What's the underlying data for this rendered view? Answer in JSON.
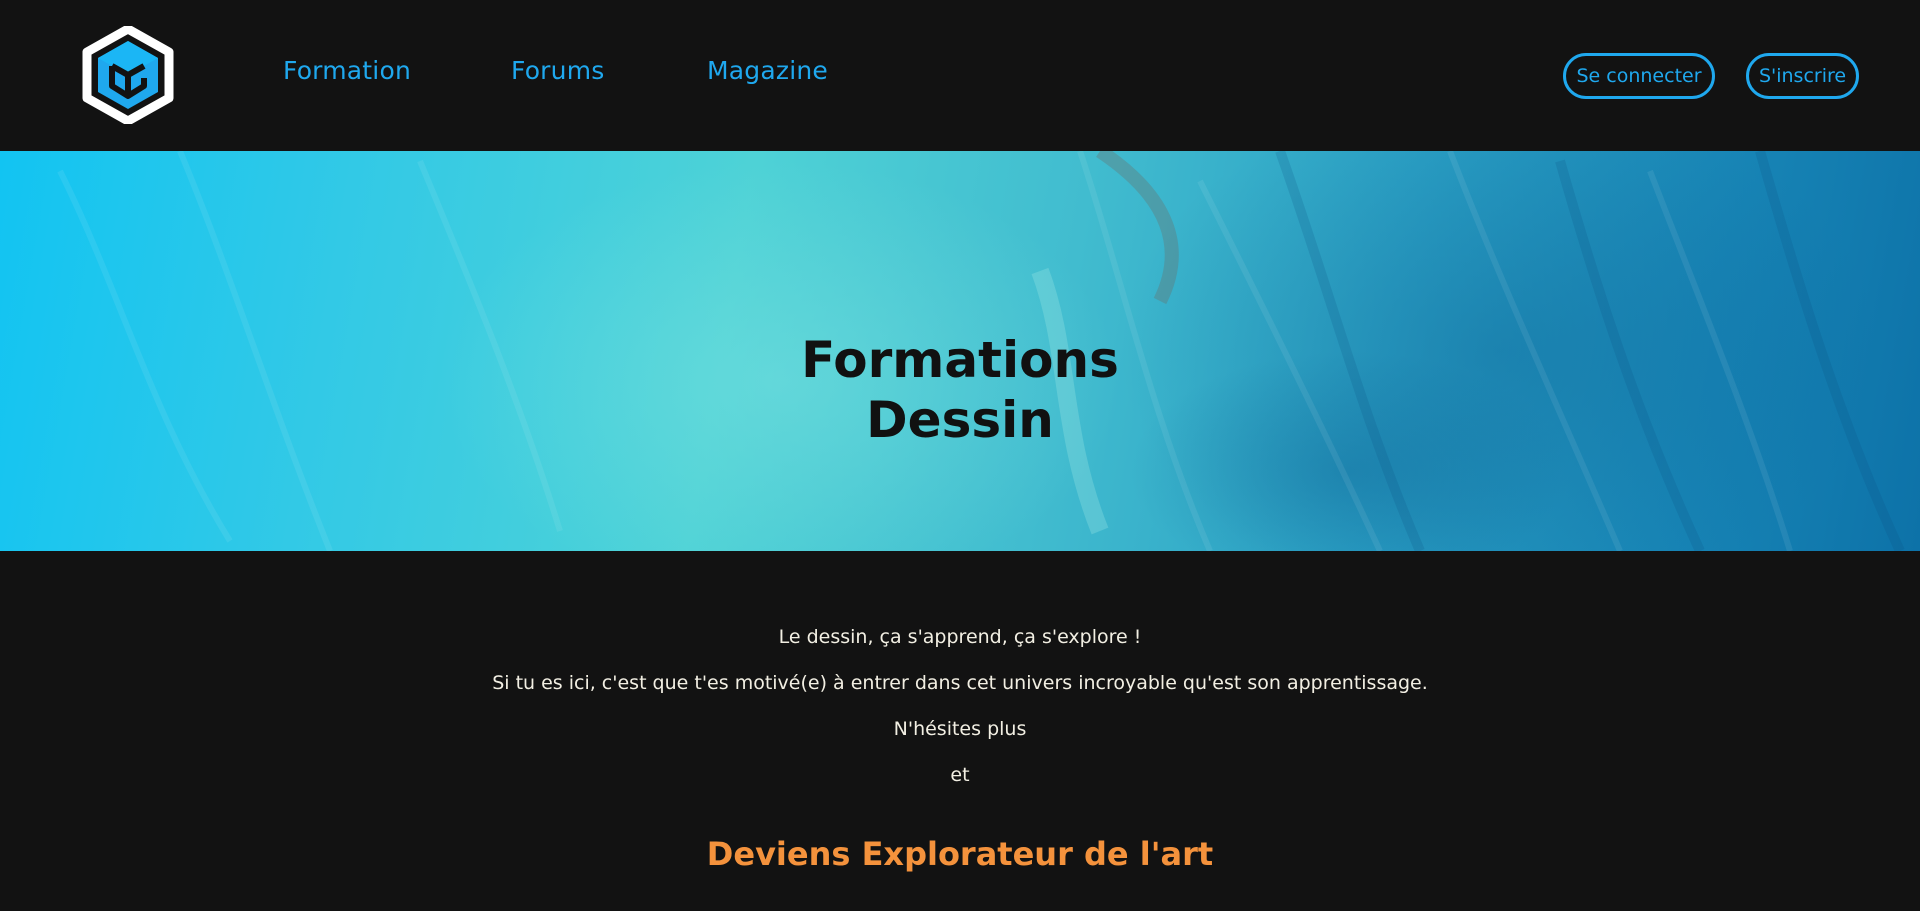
{
  "header": {
    "logo_icon": "hexagon-cube-logo",
    "nav": [
      {
        "label": "Formation"
      },
      {
        "label": "Forums"
      },
      {
        "label": "Magazine"
      }
    ],
    "login_label": "Se connecter",
    "signup_label": "S'inscrire",
    "accent_color": "#1fa8ee"
  },
  "hero": {
    "title_line1": "Formations",
    "title_line2": "Dessin"
  },
  "intro": {
    "line1": "Le dessin, ça s'apprend, ça s'explore !",
    "line2": "Si tu es ici, c'est que t'es motivé(e) à entrer dans cet univers incroyable qu'est son apprentissage.",
    "line3": "N'hésites plus",
    "line4": "et"
  },
  "cta": {
    "heading": "Deviens Explorateur de l'art",
    "color": "#f4923c"
  }
}
